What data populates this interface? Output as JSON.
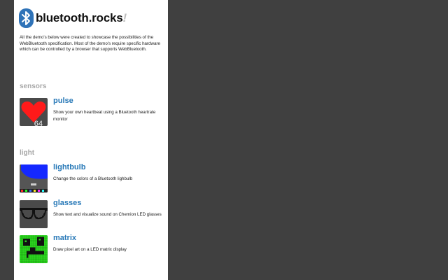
{
  "site": {
    "brand": "bluetooth.rocks",
    "brand_mark": "!",
    "logo_icon": "bluetooth-icon"
  },
  "intro": "All the demo's below were created to showcase the possibilities of the WebBluetooth specification. Most of the demo's require specific hardware which can be controlled by a browser that supports WebBluetooth.",
  "sections": [
    {
      "title": "sensors",
      "items": [
        {
          "title": "pulse",
          "description": "Show your own heartbeat using a Bluetooth heartrate monitor",
          "thumb_value": "64",
          "icon": "heart-icon"
        }
      ]
    },
    {
      "title": "light",
      "items": [
        {
          "title": "lightbulb",
          "description": "Change the colors of a Bluetooth lighbulb",
          "icon": "lightbulb-icon"
        },
        {
          "title": "glasses",
          "description": "Show text and visualize sound on Chemion LED glasses",
          "icon": "glasses-icon"
        },
        {
          "title": "matrix",
          "description": "Draw pixel art on a LED matrix display",
          "icon": "matrix-icon"
        }
      ]
    }
  ],
  "colors": {
    "background": "#404040",
    "panel": "#ffffff",
    "link": "#2a7ab8",
    "section_title": "#a7a7a7",
    "bluetooth_blue": "#2f73b8",
    "heart": "#ff1a1a",
    "matrix_green": "#2bd41f"
  }
}
